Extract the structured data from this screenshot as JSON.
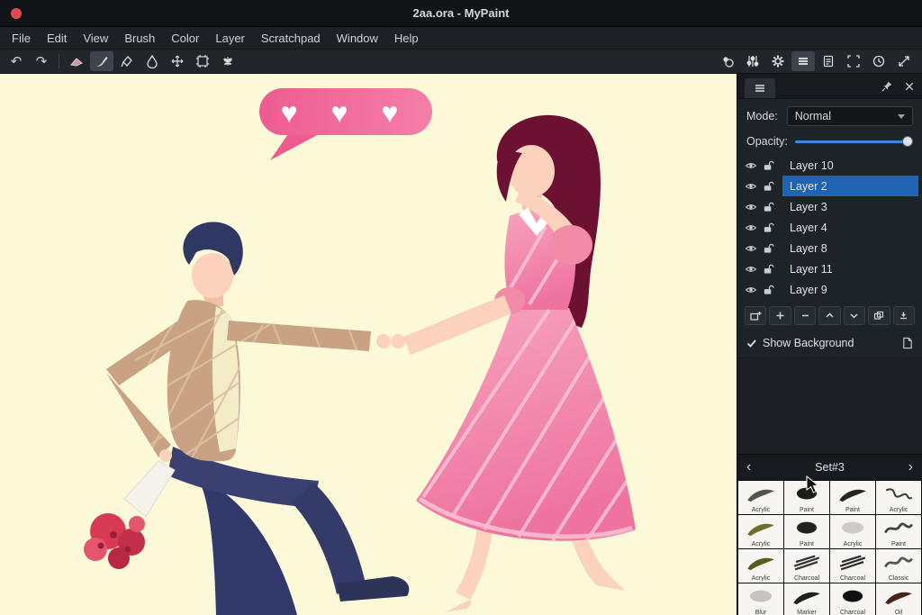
{
  "window": {
    "title": "2aa.ora - MyPaint"
  },
  "menu": {
    "items": [
      "File",
      "Edit",
      "View",
      "Brush",
      "Color",
      "Layer",
      "Scratchpad",
      "Window",
      "Help"
    ]
  },
  "toolbar": {
    "left_tools": [
      "undo",
      "redo",
      "eraser",
      "paintbrush",
      "ink-pen",
      "smudge",
      "move",
      "frame",
      "symmetry"
    ],
    "right_tools": [
      "color-sampler",
      "brush-settings",
      "preferences",
      "layers-list",
      "document",
      "fullscreen",
      "history",
      "expand"
    ],
    "undo_glyph": "↶",
    "redo_glyph": "↷"
  },
  "layers_panel": {
    "mode_label": "Mode:",
    "mode_value": "Normal",
    "opacity_label": "Opacity:",
    "opacity_percent": 100,
    "layers": [
      {
        "name": "Layer 10",
        "selected": false
      },
      {
        "name": "Layer 2",
        "selected": true
      },
      {
        "name": "Layer 3",
        "selected": false
      },
      {
        "name": "Layer 4",
        "selected": false
      },
      {
        "name": "Layer 8",
        "selected": false
      },
      {
        "name": "Layer 11",
        "selected": false
      },
      {
        "name": "Layer 9",
        "selected": false
      }
    ],
    "show_background_label": "Show Background"
  },
  "brush_panel": {
    "set_label": "Set#3",
    "prev_glyph": "‹",
    "next_glyph": "›",
    "brushes": [
      "Acrylic",
      "Paint",
      "Paint",
      "Acrylic",
      "Acrylic",
      "Paint",
      "Acrylic",
      "Paint",
      "Acrylic",
      "Charcoal",
      "Charcoal",
      "Classic",
      "Blur",
      "Marker",
      "Charcoal",
      "Oil"
    ]
  },
  "illustration": {
    "hearts": "♥ ♥ ♥"
  },
  "colors": {
    "selection_blue": "#1f63b5",
    "canvas_bg": "#fbf9d8",
    "slider_accent": "#3f86e0",
    "bubble_pink": "#ee5b90",
    "dress_pink": "#f48ab0",
    "close_red": "#e14b50"
  }
}
